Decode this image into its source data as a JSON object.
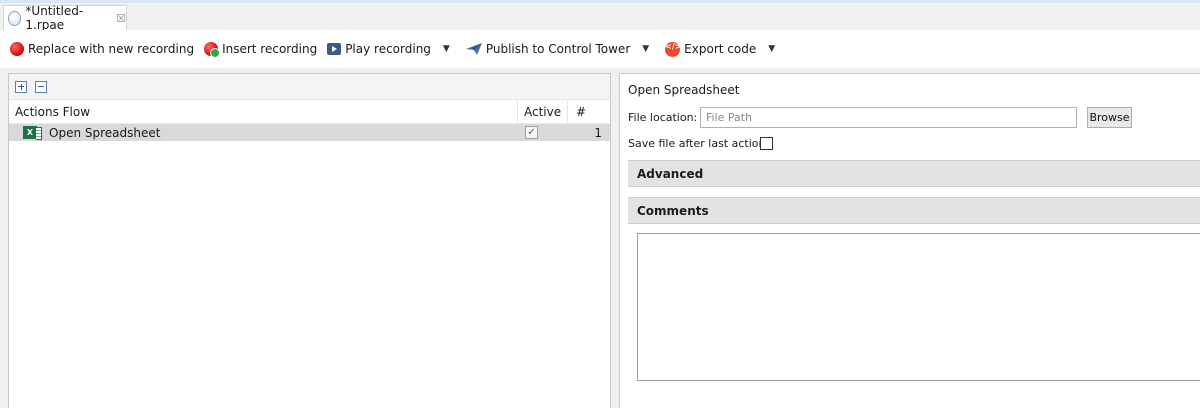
{
  "tab": {
    "title": "*Untitled-1.rpae",
    "close_symbol": "☒"
  },
  "toolbar": {
    "replace_label": "Replace with new recording",
    "insert_label": "Insert recording",
    "play_label": "Play recording",
    "publish_label": "Publish to Control Tower",
    "export_label": "Export code",
    "dropdown_symbol": "▼"
  },
  "actions": {
    "columns": {
      "flow": "Actions Flow",
      "active": "Active",
      "num": "#"
    },
    "rows": [
      {
        "name": "Open Spreadsheet",
        "active_mark": "✓",
        "num": "1"
      }
    ]
  },
  "details": {
    "title": "Open Spreadsheet",
    "file_location_label": "File location:",
    "file_path_placeholder": "File Path",
    "browse_label": "Browse",
    "save_after_label": "Save file after last action",
    "advanced_label": "Advanced",
    "comments_label": "Comments"
  },
  "colors": {
    "record_red": "#d50000",
    "excel_green": "#1e7145",
    "export_orange": "#e94b2b"
  },
  "icons": {
    "tab": "document-globe-icon",
    "replace": "record-icon",
    "insert": "insert-record-icon",
    "play": "play-icon",
    "publish": "paper-plane-icon",
    "export": "code-icon",
    "expand": "expand-all-icon",
    "collapse": "collapse-all-icon",
    "excel": "excel-icon"
  }
}
